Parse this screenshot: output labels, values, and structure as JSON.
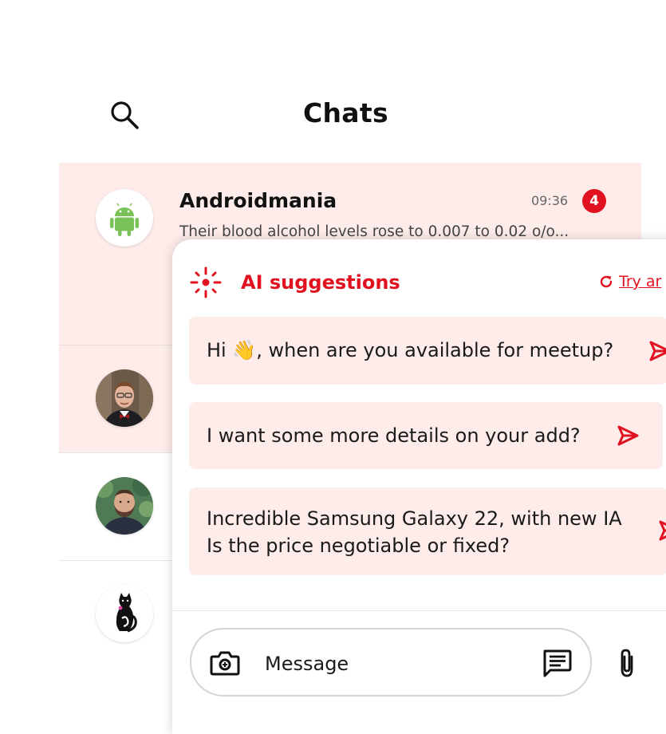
{
  "header": {
    "title": "Chats",
    "search_icon": "search-icon"
  },
  "chats": [
    {
      "name": "Androidmania",
      "time": "09:36",
      "unread": "4",
      "preview": "Their blood alcohol levels rose to 0.007 to 0.02 o/o...",
      "avatar": "android-logo"
    },
    {
      "avatar": "man-with-bowtie-photo"
    },
    {
      "avatar": "bearded-man-photo"
    },
    {
      "avatar": "black-cat-logo"
    }
  ],
  "ai_panel": {
    "title": "AI suggestions",
    "try_again": "Try ar",
    "suggestions": [
      {
        "text": "Hi 👋, when are you available for meetup?"
      },
      {
        "text": "I want some more details on your add?"
      },
      {
        "line1": "Incredible Samsung Galaxy 22, with new IA",
        "line2": "Is the price negotiable or fixed?"
      }
    ]
  },
  "composer": {
    "placeholder": "Message"
  },
  "colors": {
    "accent": "#e1121f",
    "highlight_bg": "#fdecea",
    "android_green": "#78c257"
  }
}
